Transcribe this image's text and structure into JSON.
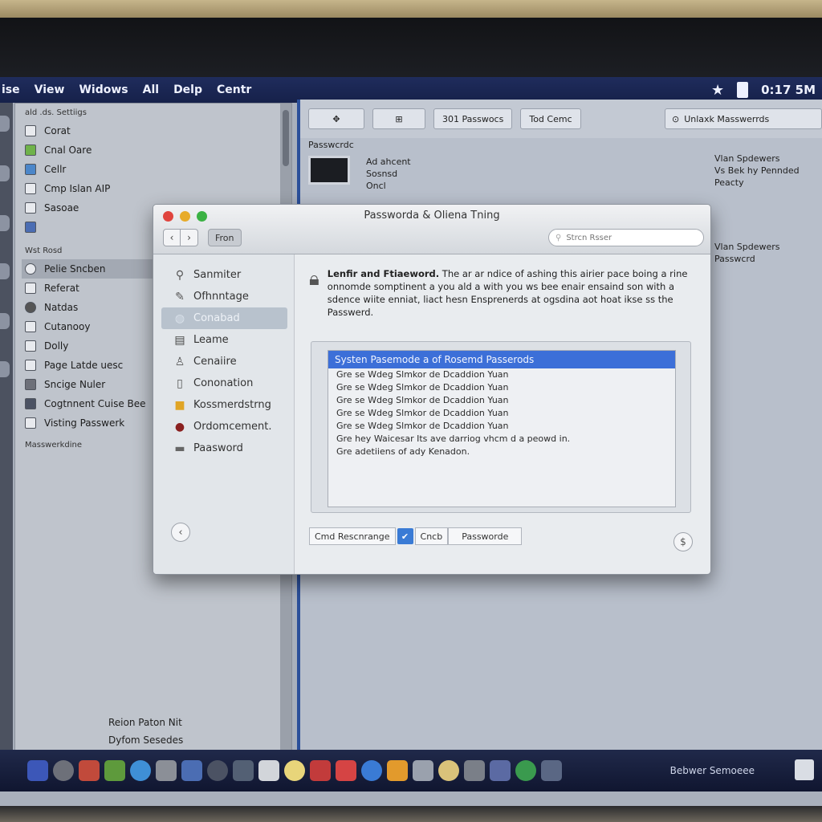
{
  "menubar": {
    "items": [
      "ise",
      "View",
      "Widows",
      "All",
      "Delp",
      "Centr"
    ],
    "clock": "0:17 5M",
    "icons": [
      "star-icon",
      "battery-icon"
    ]
  },
  "left_window": {
    "header": "ald .ds. Settiigs",
    "section1": [
      "Corat",
      "Cnal Oare",
      "Cellr",
      "Cmp Islan AIP",
      "Sasoae",
      ""
    ],
    "section2_header": "Wst Rosd",
    "section2": [
      "Pelie Sncben",
      "Referat",
      "Natdas",
      "Cutanooy",
      "Dolly",
      "Page Latde uesc",
      "Sncige Nuler",
      "Cogtnnent Cuise Bee",
      "Visting Passwerk"
    ],
    "separator_label": "Masswerkdine",
    "footer": [
      "Reion Paton Nit",
      "Dyfom Sesedes"
    ]
  },
  "right_window": {
    "toolbar": {
      "btn1": "✥",
      "btn2": "⊞",
      "btn3": "301 Passwocs",
      "btn4": "Tod Cemc",
      "search": "Unlaxk Masswerrds"
    },
    "row_label": "Passwcrdc",
    "item_lines": [
      "Ad ahcent",
      "Sosnsd",
      "Oncl"
    ],
    "note1": [
      "Vlan Spdewers",
      "Vs Bek hy Pennded",
      "Peacty"
    ],
    "note2": [
      "Vlan Spdewers",
      "Passwcrd"
    ]
  },
  "dialog": {
    "title": "Passworda & Oliena Tning",
    "from_label": "Fron",
    "search_placeholder": "Strcn Rsser",
    "sidebar": [
      {
        "icon": "search-icon",
        "label": "Sanmiter"
      },
      {
        "icon": "pencil-icon",
        "label": "Ofhnntage"
      },
      {
        "icon": "globe-icon",
        "label": "Conabad"
      },
      {
        "icon": "book-icon",
        "label": "Leame"
      },
      {
        "icon": "person-icon",
        "label": "Cenaiire"
      },
      {
        "icon": "document-icon",
        "label": "Cononation"
      },
      {
        "icon": "folder-icon",
        "label": "Kossmerdstrng"
      },
      {
        "icon": "record-icon",
        "label": "Ordomcement."
      },
      {
        "icon": "box-icon",
        "label": "Paasword"
      }
    ],
    "description_bold": "Lenfir and Ftiaeword.",
    "description_text": " The ar ar ndice of ashing this airier pace boing a rine onnomde somptinent a you ald a with you ws bee enair ensaind son with a sdence wiite enniat, liact hesn Ensprenerds at ogsdina aot hoat ikse ss the Passwerd.",
    "list_header": "Systen Pasemode a of Rosemd Passerods",
    "list_lines": [
      "Gre se Wdeg Slmkor de Dcaddion Yuan",
      "Gre se Wdeg Slmkor de Dcaddion Yuan",
      "Gre se Wdeg Slmkor de Dcaddion Yuan",
      "Gre se Wdeg Slmkor de Dcaddion Yuan",
      "Gre se Wdeg Slmkor de Dcaddion Yuan",
      "Gre hey Waicesar Its ave darriog vhcm d a peowd in.",
      "Gre adetiiens of ady Kenadon."
    ],
    "field1": "Cmd Rescnrange",
    "check": "✔",
    "field2": "Cncb",
    "field3": "Passworde",
    "help": "$",
    "back": "‹"
  },
  "dock": {
    "label": "Bebwer Semoeee",
    "icon_colors": [
      "#3c57b8",
      "#6d7079",
      "#c14a3b",
      "#5e9a3c",
      "#3f8fd6",
      "#8b8f97",
      "#4b6db3",
      "#4b5263",
      "#536074",
      "#d2d5da",
      "#e8d57a",
      "#c23b3b",
      "#d54444",
      "#3a7bd5",
      "#e29a2c",
      "#9aa1ad",
      "#d9c27a",
      "#7a7f88",
      "#5b6aa3",
      "#3a9a4e",
      "#5a6784"
    ]
  }
}
